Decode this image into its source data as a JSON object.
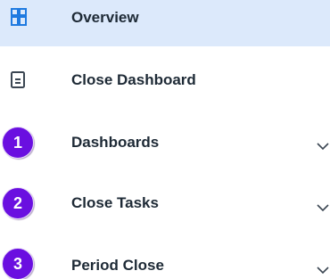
{
  "nav": {
    "items": [
      {
        "label": "Overview",
        "icon": "dashboard-grid-icon",
        "active": true
      },
      {
        "label": "Close Dashboard",
        "icon": "document-icon",
        "active": false
      },
      {
        "label": "Dashboards",
        "icon": "chevron-down-icon",
        "badge": "1",
        "expandable": true
      },
      {
        "label": "Close Tasks",
        "icon": "chevron-down-icon",
        "badge": "2",
        "expandable": true
      },
      {
        "label": "Period Close",
        "icon": "chevron-down-icon",
        "badge": "3",
        "expandable": true
      }
    ]
  },
  "colors": {
    "active_background": "#dce9fb",
    "icon_blue": "#1f7ae0",
    "badge_purple": "#6a0fe0",
    "label_text": "#1e2a36",
    "chevron": "#3b4652"
  }
}
